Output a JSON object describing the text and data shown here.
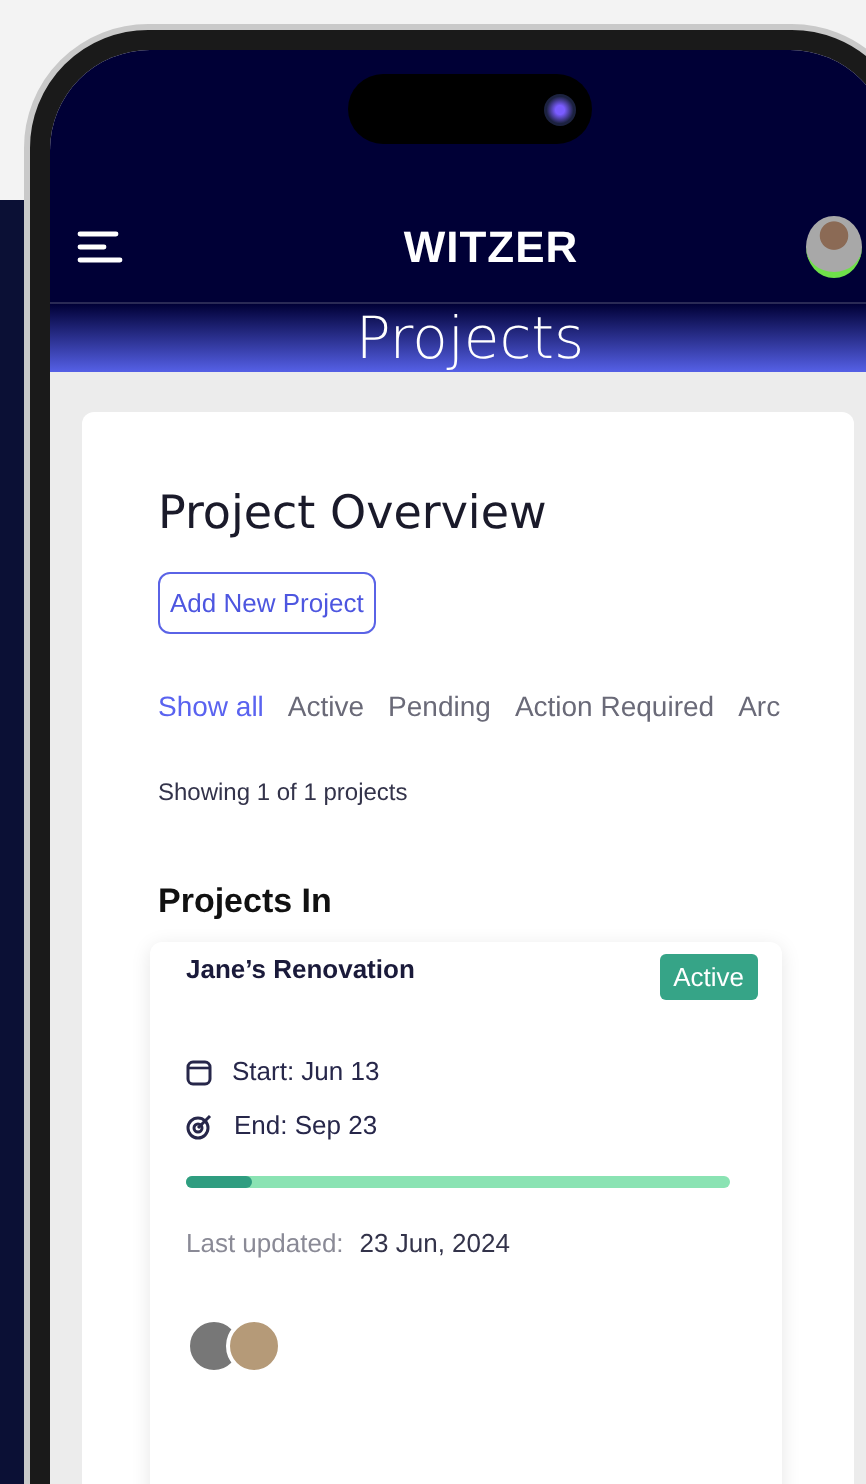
{
  "app_bar": {
    "brand": "WITZER"
  },
  "page_title": "Projects",
  "overview": {
    "title": "Project Overview",
    "add_button": "Add New Project",
    "filters": [
      {
        "label": "Show all",
        "selected": true
      },
      {
        "label": "Active",
        "selected": false
      },
      {
        "label": "Pending",
        "selected": false
      },
      {
        "label": "Action Required",
        "selected": false
      },
      {
        "label": "Arc",
        "selected": false
      }
    ],
    "count_text": "Showing 1 of 1 projects"
  },
  "section_title": "Projects In",
  "projects": [
    {
      "name": "Jane’s Renovation",
      "status": "Active",
      "color": "#36a487",
      "start": "Start: Jun 13",
      "end": "End: Sep 23",
      "level": 0.12,
      "updated_label": "Last updated:",
      "updated_value": "23 Jun, 2024"
    }
  ]
}
